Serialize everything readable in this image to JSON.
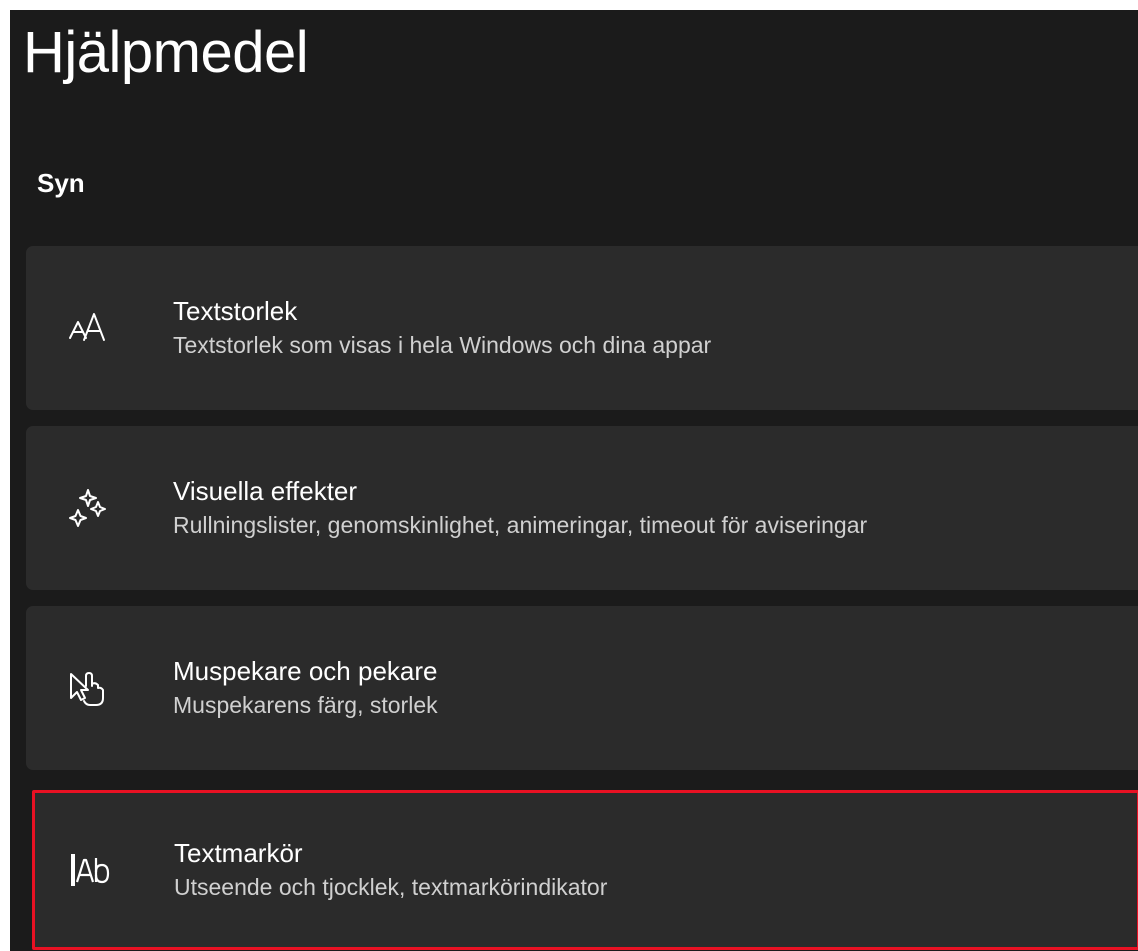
{
  "page": {
    "title": "Hjälpmedel"
  },
  "section": {
    "heading": "Syn"
  },
  "items": [
    {
      "title": "Textstorlek",
      "subtitle": "Textstorlek som visas i hela Windows och dina appar",
      "icon": "text-size-icon"
    },
    {
      "title": "Visuella effekter",
      "subtitle": "Rullningslister, genomskinlighet, animeringar, timeout för aviseringar",
      "icon": "sparkle-icon"
    },
    {
      "title": "Muspekare och pekare",
      "subtitle": "Muspekarens färg, storlek",
      "icon": "mouse-pointer-hand-icon"
    },
    {
      "title": "Textmarkör",
      "subtitle": "Utseende och tjocklek, textmarkörindikator",
      "icon": "text-cursor-icon"
    }
  ],
  "colors": {
    "window_background": "#1b1b1b",
    "card_background": "#2b2b2b",
    "highlight_border": "#e81123",
    "text_primary": "#ffffff",
    "text_secondary": "#d0d0d0"
  }
}
